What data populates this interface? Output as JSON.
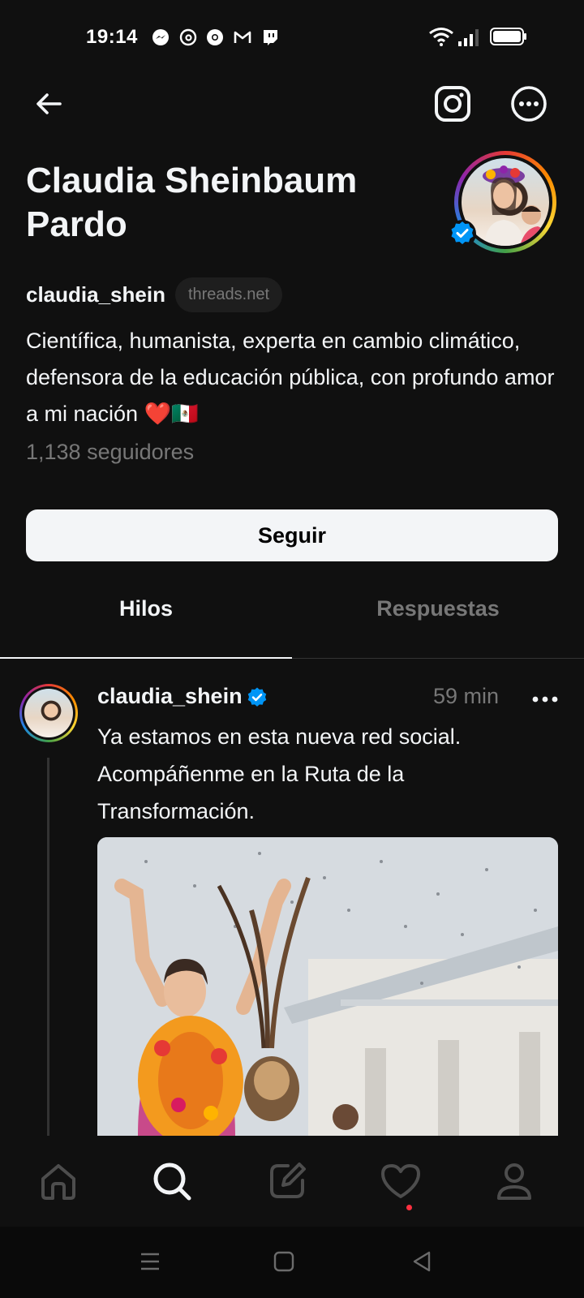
{
  "status_bar": {
    "time": "19:14",
    "notification_icons": [
      "messenger-icon",
      "threads-icon",
      "chrome-icon",
      "gmail-icon",
      "twitch-icon"
    ],
    "right_icons": [
      "wifi-icon",
      "signal-icon",
      "battery-icon"
    ]
  },
  "header": {
    "back_icon": "arrow-left-icon",
    "instagram_icon": "instagram-icon",
    "more_icon": "more-circle-icon"
  },
  "profile": {
    "name": "Claudia Sheinbaum Pardo",
    "username": "claudia_shein",
    "domain_chip": "threads.net",
    "bio": "Científica, humanista, experta en cambio climático, defensora de la educación pública, con profundo amor a mi nación ❤️🇲🇽",
    "followers": "1,138 seguidores",
    "verified": true,
    "follow_button": "Seguir"
  },
  "tabs": [
    {
      "label": "Hilos",
      "active": true
    },
    {
      "label": "Respuestas",
      "active": false
    }
  ],
  "post": {
    "username": "claudia_shein",
    "time": "59 min",
    "text": "Ya estamos en esta nueva red social. Acompáñenme en la Ruta de la Transformación."
  },
  "bottom_nav": [
    "home-icon",
    "search-icon",
    "compose-icon",
    "heart-icon",
    "profile-icon"
  ],
  "system_nav": [
    "menu-icon",
    "home-square-icon",
    "back-triangle-icon"
  ],
  "colors": {
    "background": "#101010",
    "text_primary": "#f3f5f7",
    "text_secondary": "#777777",
    "verified_blue": "#0095f6",
    "notification_dot": "#ff3040"
  }
}
